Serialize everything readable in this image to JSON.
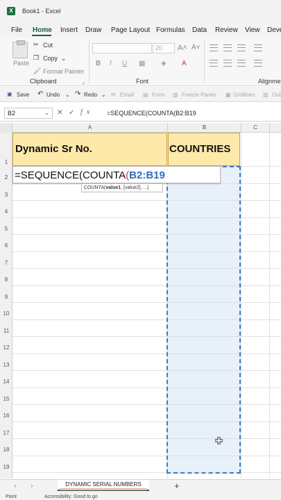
{
  "window": {
    "title": "Book1 - Excel",
    "logo": "X"
  },
  "menu": {
    "items": [
      "File",
      "Home",
      "Insert",
      "Draw",
      "Page Layout",
      "Formulas",
      "Data",
      "Review",
      "View",
      "Deve"
    ],
    "active": "Home"
  },
  "ribbon": {
    "clipboard": {
      "paste": "Paste",
      "cut": "Cut",
      "copy": "Copy",
      "format_painter": "Format Painter",
      "group_label": "Clipboard"
    },
    "font": {
      "font_size": "20",
      "bold": "B",
      "italic": "I",
      "underline": "U",
      "group_label": "Font"
    },
    "alignment": {
      "group_label": "Alignmen"
    }
  },
  "qat": {
    "save": "Save",
    "undo": "Undo",
    "redo": "Redo",
    "email": "Email",
    "form": "Form",
    "freeze": "Freeze Panes",
    "gridlines": "Gridlines",
    "out": "Out"
  },
  "formula_bar": {
    "name_box": "B2",
    "fx": "fx",
    "formula": "=SEQUENCE(COUNTA(B2:B19"
  },
  "columns": [
    "A",
    "B",
    "C"
  ],
  "rows": [
    "1",
    "2",
    "3",
    "4",
    "5",
    "6",
    "7",
    "8",
    "9",
    "10",
    "11",
    "12",
    "13",
    "14",
    "15",
    "16",
    "17",
    "18",
    "19"
  ],
  "cells": {
    "a1": "Dynamic Sr No.",
    "b1": "COUNTRIES",
    "edit_prefix": "=SEQUENCE(COUNTA",
    "edit_paren": "(",
    "edit_ref": "B2:B19"
  },
  "tooltip": {
    "func": "COUNTA(",
    "arg1": "value1",
    "rest": ", [value2], ...)"
  },
  "sheet_tab": {
    "name": "DYNAMIC SERIAL NUMBERS",
    "add": "+"
  },
  "status": {
    "mode": "Point",
    "accessibility": "Accessibility: Good to go"
  },
  "colors": {
    "header_fill": "#fde9a9",
    "selection": "#3a7bbf",
    "excel_green": "#185c37"
  }
}
